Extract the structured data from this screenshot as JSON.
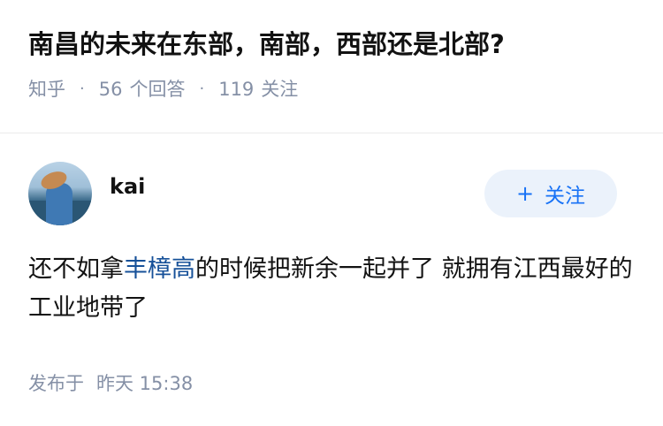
{
  "question": {
    "title": "南昌的未来在东部，南部，西部还是北部?",
    "source": "知乎",
    "answers_count": "56",
    "answers_label": "个回答",
    "followers_count": "119",
    "followers_label": "关注"
  },
  "answer": {
    "author_name": "kai",
    "follow_button_label": "关注",
    "content_before_link": "还不如拿",
    "content_link": "丰樟高",
    "content_after_link": "的时候把新余一起并了 就拥有江西最好的工业地带了",
    "published_label": "发布于",
    "published_time": "昨天 15:38"
  },
  "colors": {
    "link": "#175199",
    "accent": "#1772f6",
    "meta": "#8590a6"
  }
}
